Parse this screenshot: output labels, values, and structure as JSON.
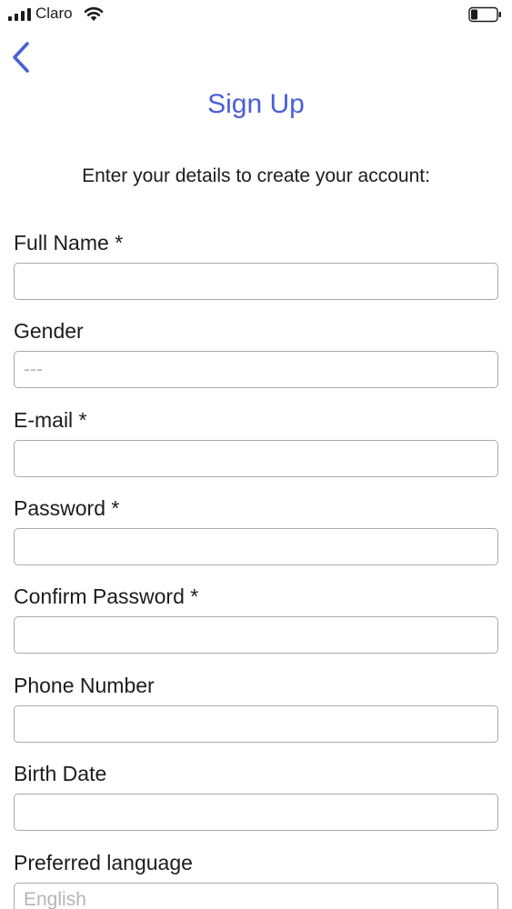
{
  "status_bar": {
    "carrier": "Claro"
  },
  "header": {
    "title": "Sign Up",
    "subtitle": "Enter your details to create your account:"
  },
  "fields": [
    {
      "label": "Full Name *",
      "value": "",
      "placeholder": ""
    },
    {
      "label": "Gender",
      "value": "",
      "placeholder": "---"
    },
    {
      "label": "E-mail *",
      "value": "",
      "placeholder": ""
    },
    {
      "label": "Password *",
      "value": "",
      "placeholder": ""
    },
    {
      "label": "Confirm Password *",
      "value": "",
      "placeholder": ""
    },
    {
      "label": "Phone Number",
      "value": "",
      "placeholder": ""
    },
    {
      "label": "Birth Date",
      "value": "",
      "placeholder": ""
    },
    {
      "label": "Preferred language",
      "value": "",
      "placeholder": "English"
    }
  ],
  "colors": {
    "accent": "#4a5fd8",
    "input_border": "#a9a9a9",
    "placeholder": "#b5b5b5"
  },
  "icons": {
    "signal": "cellular-signal-icon",
    "wifi": "wifi-icon",
    "battery": "battery-icon",
    "back": "chevron-left-icon"
  }
}
